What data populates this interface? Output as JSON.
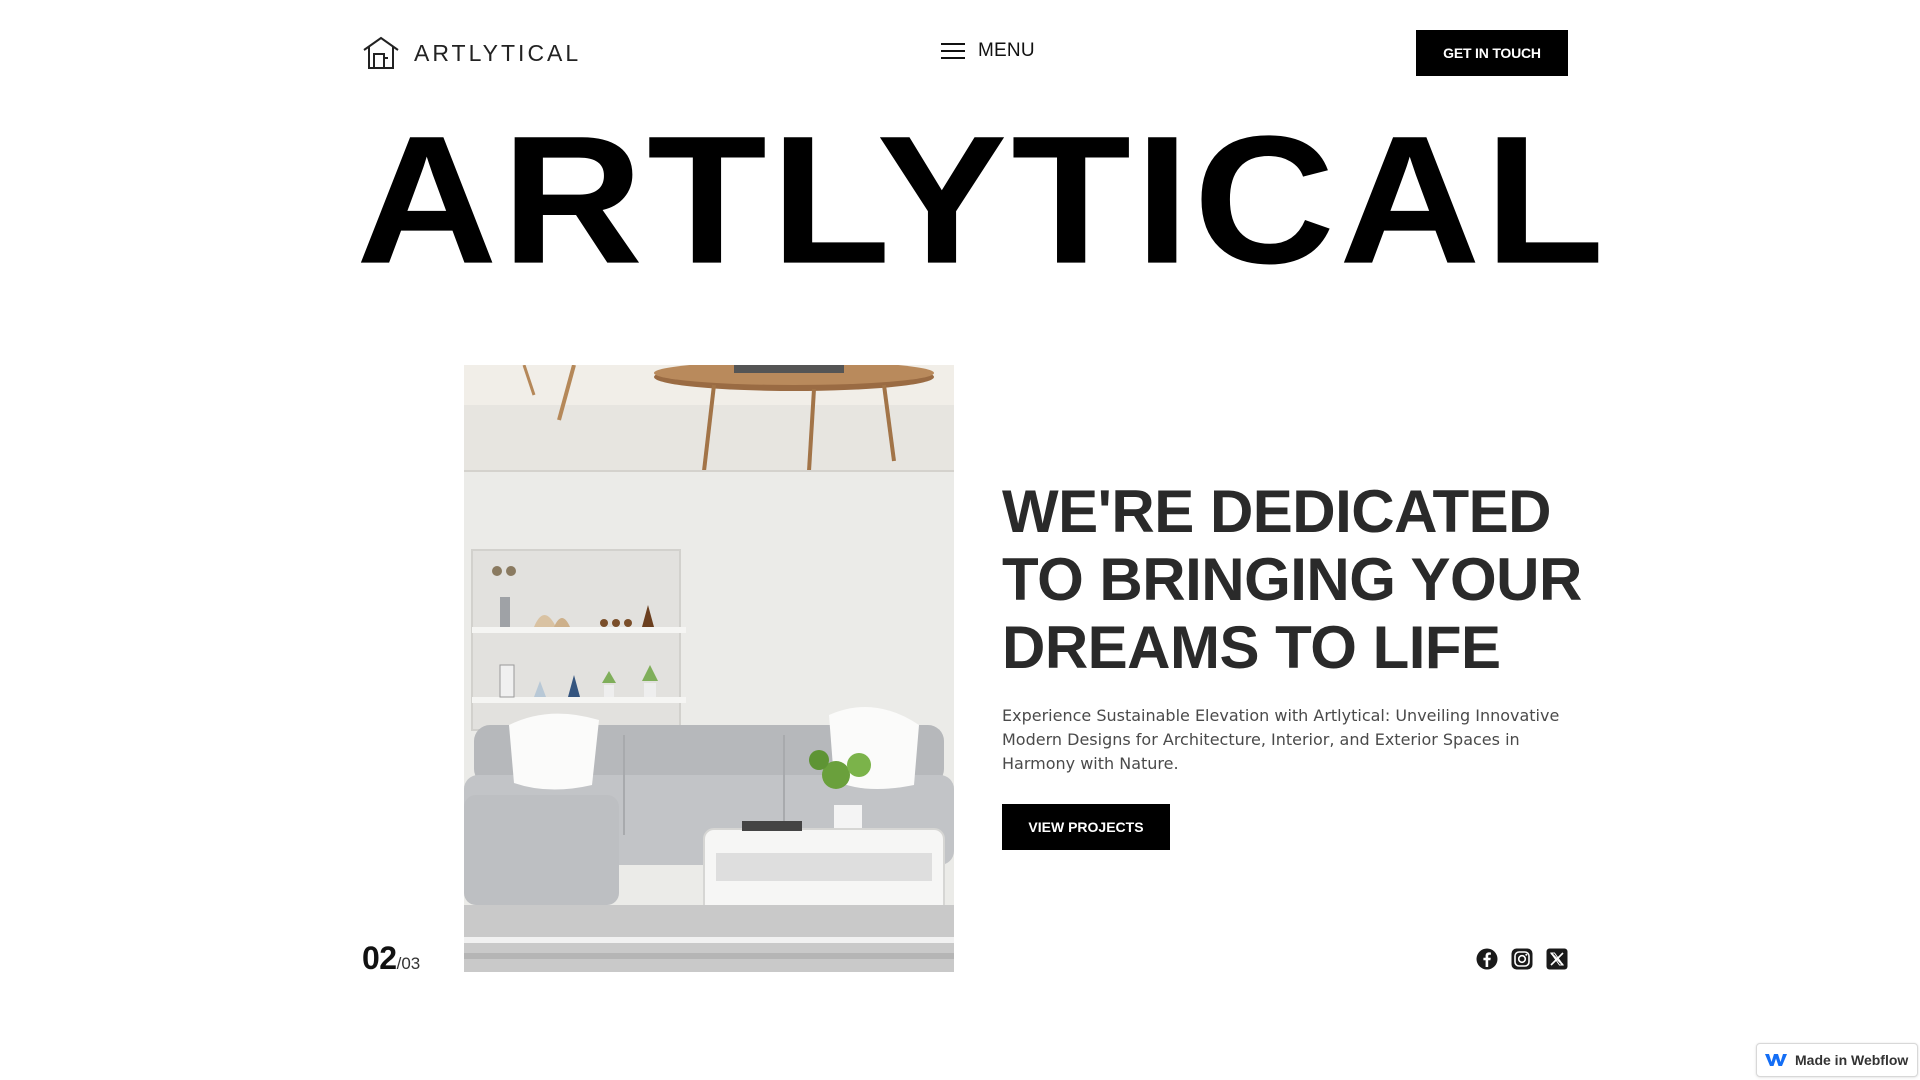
{
  "header": {
    "logo_text": "ARTLYTICAL",
    "menu_label": "MENU",
    "cta_label": "GET IN TOUCH"
  },
  "hero": {
    "big_title": "ARTLYTICAL",
    "headline_lines": [
      "WE'RE DEDICATED",
      "TO BRINGING YOUR",
      "DREAMS TO LIFE"
    ],
    "description": "Experience Sustainable Elevation with Artlytical: Unveiling Innovative Modern Designs for Architecture, Interior, and Exterior Spaces in Harmony with Nature.",
    "button_label": "VIEW PROJECTS",
    "image_icon": "living-room-interior-image"
  },
  "slider": {
    "current": "02",
    "total": "/03"
  },
  "socials": [
    {
      "icon": "facebook-icon"
    },
    {
      "icon": "instagram-icon"
    },
    {
      "icon": "x-twitter-icon"
    }
  ],
  "badge": {
    "label": "Made in Webflow",
    "icon": "webflow-logo-icon"
  },
  "colors": {
    "background": "#ffffff",
    "text": "#000000",
    "headline": "#2a2a2a",
    "button": "#000000",
    "button_text": "#ffffff"
  }
}
